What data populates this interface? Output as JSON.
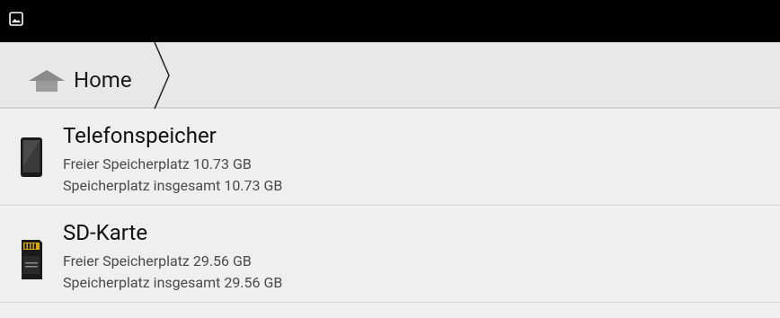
{
  "statusbar": {
    "icon": "image-icon"
  },
  "breadcrumb": {
    "home_label": "Home",
    "home_icon": "home-icon",
    "separator_icon": "chevron-right-icon"
  },
  "storage": [
    {
      "icon": "phone-icon",
      "title": "Telefonspeicher",
      "free": "Freier Speicherplatz 10.73 GB",
      "total": "Speicherplatz insgesamt 10.73 GB"
    },
    {
      "icon": "sd-card-icon",
      "title": "SD-Karte",
      "free": "Freier Speicherplatz 29.56 GB",
      "total": "Speicherplatz insgesamt 29.56 GB"
    }
  ]
}
